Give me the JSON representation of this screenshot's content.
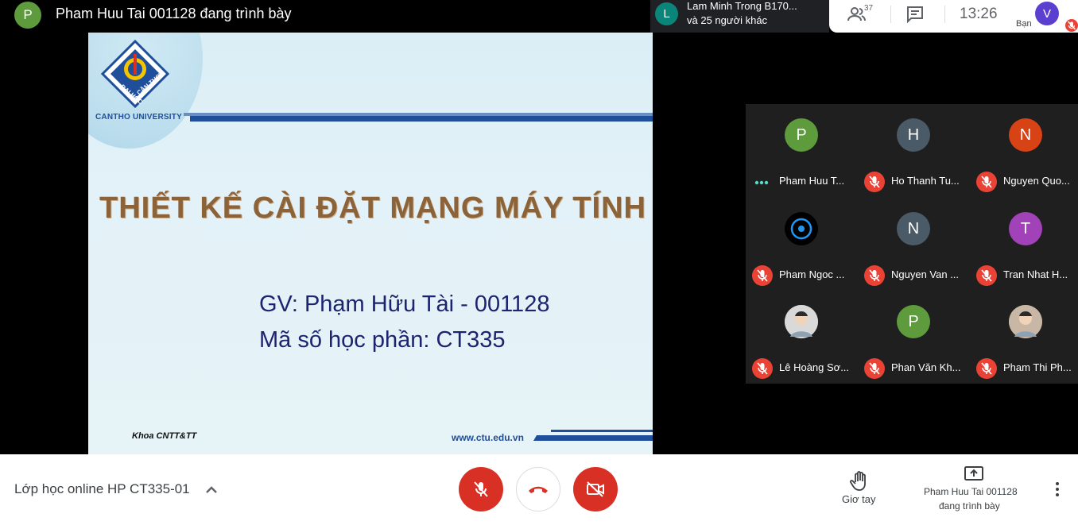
{
  "presenter": {
    "initial": "P",
    "text": "Pham Huu Tai 001128 đang trình bày"
  },
  "active_speaker": {
    "initial": "L",
    "name": "Lam Minh Trong B170...",
    "others": "và 25 người khác"
  },
  "topbar": {
    "participants_count": "37",
    "time": "13:26",
    "self_initial": "V",
    "self_label": "Bạn"
  },
  "slide": {
    "university": "CANTHO UNIVERSITY",
    "logo_lines": [
      "ĐẠI HỌC",
      "CẦN THƠ"
    ],
    "title": "THIẾT KẾ CÀI ĐẶT MẠNG MÁY TÍNH",
    "teacher": "GV: Phạm Hữu Tài - 001128",
    "course_code": "Mã số học phần: CT335",
    "faculty": "Khoa CNTT&TT",
    "website": "www.ctu.edu.vn"
  },
  "participants": [
    {
      "initial": "P",
      "name": "Pham Huu T...",
      "color": "#5d9b3c",
      "status": "speaking"
    },
    {
      "initial": "H",
      "name": "Ho Thanh Tu...",
      "color": "#4a5a66",
      "status": "muted"
    },
    {
      "initial": "N",
      "name": "Nguyen Quo...",
      "color": "#d84315",
      "status": "muted"
    },
    {
      "initial": "",
      "name": "Pham Ngoc ...",
      "color": "#000000",
      "status": "muted",
      "icon": "ring-avatar-icon"
    },
    {
      "initial": "N",
      "name": "Nguyen Van ...",
      "color": "#4a5a66",
      "status": "muted"
    },
    {
      "initial": "T",
      "name": "Tran Nhat H...",
      "color": "#a142b8",
      "status": "muted"
    },
    {
      "initial": "",
      "name": "Lê Hoàng Sơ...",
      "color": "#d9d9d9",
      "status": "muted",
      "icon": "photo-avatar-icon"
    },
    {
      "initial": "P",
      "name": "Phan Văn Kh...",
      "color": "#5d9b3c",
      "status": "muted"
    },
    {
      "initial": "",
      "name": "Pham Thi Ph...",
      "color": "#c9b7a6",
      "status": "muted",
      "icon": "photo-avatar-icon"
    }
  ],
  "bottom": {
    "meeting_name": "Lớp học online HP CT335-01",
    "raise_hand": "Giơ tay",
    "presenting_line1": "Pham Huu Tai 001128",
    "presenting_line2": "đang trình bày"
  }
}
